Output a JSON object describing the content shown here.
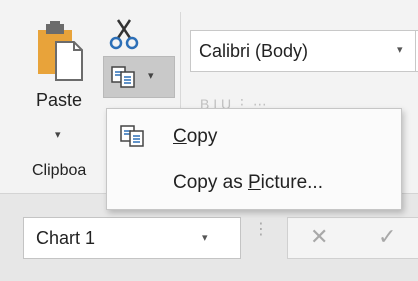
{
  "ribbon": {
    "paste_label": "Paste",
    "paste_dropdown_glyph": "▾",
    "copy_dropdown_glyph": "▾",
    "group_label": "Clipboa",
    "font_name": "Calibri (Body)",
    "font_dropdown_glyph": "▾",
    "faded_tools": "B  I  U   ⋮   ⋯"
  },
  "copy_menu": {
    "items": [
      {
        "label_prefix": "",
        "accel": "C",
        "label_suffix": "opy",
        "icon": "copy-icon"
      },
      {
        "label_prefix": "Copy as ",
        "accel": "P",
        "label_suffix": "icture...",
        "icon": ""
      }
    ]
  },
  "formula_bar": {
    "name_box_value": "Chart 1",
    "name_box_dropdown_glyph": "▾",
    "grip": "⋮",
    "cancel_glyph": "✕",
    "enter_glyph": "✓"
  },
  "colors": {
    "ribbon_bg": "#f3f3f3",
    "copy_button_pressed": "#c9c9c9",
    "paste_orange": "#e8a33a"
  }
}
